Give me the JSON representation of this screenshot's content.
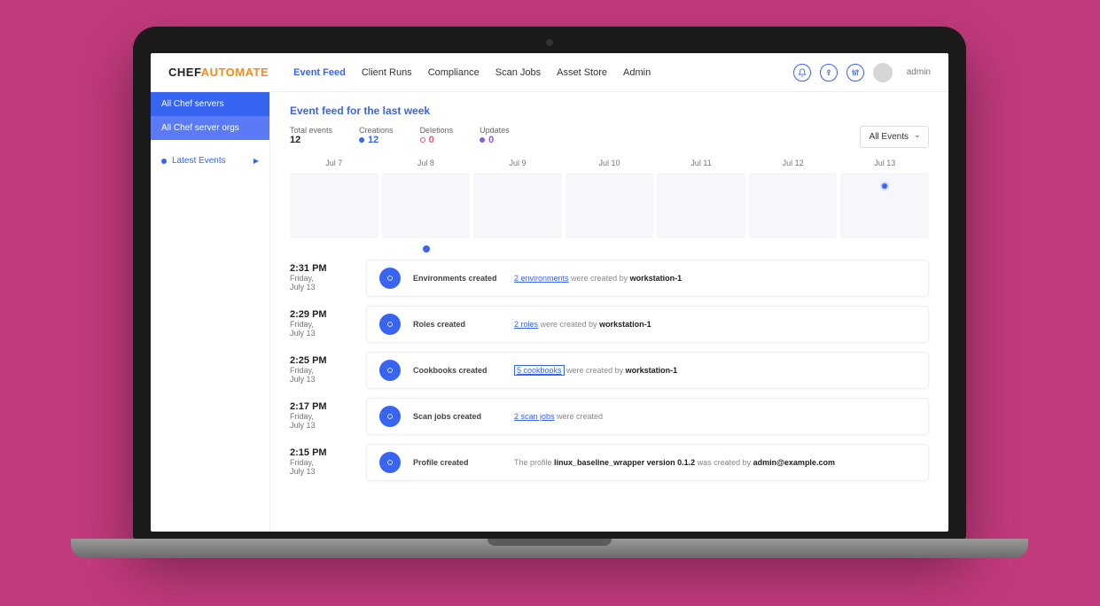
{
  "brand": {
    "part1": "CHEF",
    "part2": "AUTOMATE"
  },
  "nav": {
    "items": [
      {
        "label": "Event Feed",
        "active": true
      },
      {
        "label": "Client Runs"
      },
      {
        "label": "Compliance"
      },
      {
        "label": "Scan Jobs"
      },
      {
        "label": "Asset Store"
      },
      {
        "label": "Admin"
      }
    ]
  },
  "user": {
    "name": "admin"
  },
  "sidebar": {
    "items": [
      {
        "label": "All Chef servers"
      },
      {
        "label": "All Chef server orgs"
      }
    ],
    "latest_label": "Latest Events"
  },
  "page": {
    "title": "Event feed for the last week",
    "filter_label": "All Events"
  },
  "stats": {
    "total": {
      "label": "Total events",
      "value": "12"
    },
    "creations": {
      "label": "Creations",
      "value": "12"
    },
    "deletions": {
      "label": "Deletions",
      "value": "0"
    },
    "updates": {
      "label": "Updates",
      "value": "0"
    }
  },
  "timeline": {
    "days": [
      "Jul 7",
      "Jul 8",
      "Jul 9",
      "Jul 10",
      "Jul 11",
      "Jul 12",
      "Jul 13"
    ],
    "activity_index": 6
  },
  "events": [
    {
      "time": "2:31 PM",
      "day": "Friday,",
      "date": "July 13",
      "title": "Environments created",
      "link_text": "2 environments",
      "mid": " were created by ",
      "actor": "workstation-1"
    },
    {
      "time": "2:29 PM",
      "day": "Friday,",
      "date": "July 13",
      "title": "Roles created",
      "link_text": "2 roles",
      "mid": " were created by ",
      "actor": "workstation-1"
    },
    {
      "time": "2:25 PM",
      "day": "Friday,",
      "date": "July 13",
      "title": "Cookbooks created",
      "link_text": "5 cookbooks",
      "boxed": true,
      "mid": " were created by ",
      "actor": "workstation-1"
    },
    {
      "time": "2:17 PM",
      "day": "Friday,",
      "date": "July 13",
      "title": "Scan jobs created",
      "link_text": "2 scan jobs",
      "mid": " were created",
      "actor": ""
    },
    {
      "time": "2:15 PM",
      "day": "Friday,",
      "date": "July 13",
      "title": "Profile created",
      "prefix": "The profile ",
      "profile": "linux_baseline_wrapper version 0.1.2",
      "mid": " was created by ",
      "actor": "admin@example.com"
    }
  ]
}
